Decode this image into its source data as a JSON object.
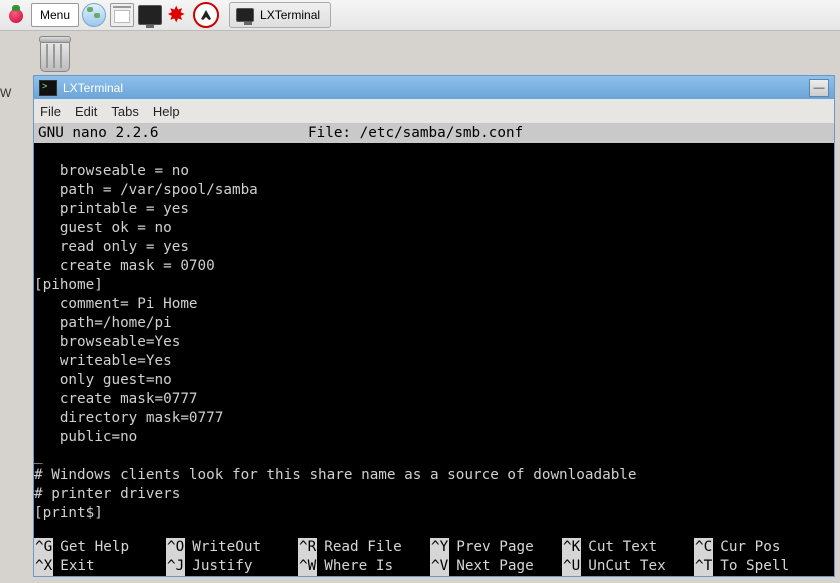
{
  "taskbar": {
    "menu_label": "Menu",
    "task_label": "LXTerminal"
  },
  "desktop": {
    "wastebasket_partial": "W"
  },
  "window": {
    "title": "LXTerminal",
    "menu": {
      "file": "File",
      "edit": "Edit",
      "tabs": "Tabs",
      "help": "Help"
    }
  },
  "nano": {
    "header_left": "  GNU nano 2.2.6",
    "header_center": "File: /etc/samba/smb.conf",
    "content": "\n   browseable = no\n   path = /var/spool/samba\n   printable = yes\n   guest ok = no\n   read only = yes\n   create mask = 0700\n[pihome]\n   comment= Pi Home\n   path=/home/pi\n   browseable=Yes\n   writeable=Yes\n   only guest=no\n   create mask=0777\n   directory mask=0777\n   public=no\n_\n# Windows clients look for this share name as a source of downloadable\n# printer drivers\n[print$]",
    "shortcuts": {
      "row1": [
        {
          "k": "^G",
          "l": "Get Help"
        },
        {
          "k": "^O",
          "l": "WriteOut"
        },
        {
          "k": "^R",
          "l": "Read File"
        },
        {
          "k": "^Y",
          "l": "Prev Page"
        },
        {
          "k": "^K",
          "l": "Cut Text"
        },
        {
          "k": "^C",
          "l": "Cur Pos"
        }
      ],
      "row2": [
        {
          "k": "^X",
          "l": "Exit"
        },
        {
          "k": "^J",
          "l": "Justify"
        },
        {
          "k": "^W",
          "l": "Where Is"
        },
        {
          "k": "^V",
          "l": "Next Page"
        },
        {
          "k": "^U",
          "l": "UnCut Tex"
        },
        {
          "k": "^T",
          "l": "To Spell"
        }
      ]
    }
  }
}
